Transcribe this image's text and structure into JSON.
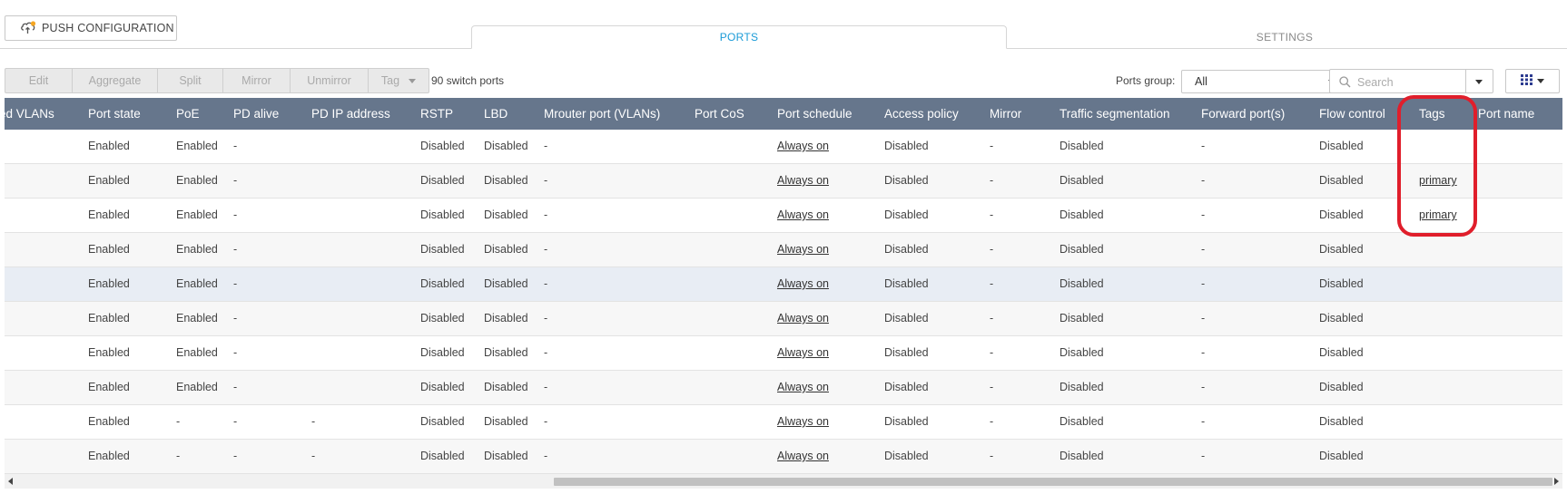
{
  "push_button": {
    "label": "PUSH CONFIGURATION",
    "icon": "cloud-upload-icon"
  },
  "tabs": [
    {
      "label": "PORTS",
      "active": true
    },
    {
      "label": "SETTINGS",
      "active": false
    }
  ],
  "toolbar": {
    "buttons": [
      "Edit",
      "Aggregate",
      "Split",
      "Mirror",
      "Unmirror",
      "Tag"
    ],
    "count_label": "90 switch ports",
    "ports_group_label": "Ports group:",
    "ports_group_value": "All",
    "search_placeholder": "Search"
  },
  "table": {
    "columns": [
      "ed VLANs",
      "Port state",
      "PoE",
      "PD alive",
      "PD IP address",
      "RSTP",
      "LBD",
      "Mrouter port (VLANs)",
      "Port CoS",
      "Port schedule",
      "Access policy",
      "Mirror",
      "Traffic segmentation",
      "Forward port(s)",
      "Flow control",
      "Tags",
      "Port name"
    ],
    "rows": [
      [
        "",
        "Enabled",
        "Enabled",
        "-",
        "",
        "Disabled",
        "Disabled",
        "-",
        "",
        "Always on",
        "Disabled",
        "-",
        "Disabled",
        "-",
        "Disabled",
        "",
        ""
      ],
      [
        "",
        "Enabled",
        "Enabled",
        "-",
        "",
        "Disabled",
        "Disabled",
        "-",
        "",
        "Always on",
        "Disabled",
        "-",
        "Disabled",
        "-",
        "Disabled",
        "primary",
        ""
      ],
      [
        "",
        "Enabled",
        "Enabled",
        "-",
        "",
        "Disabled",
        "Disabled",
        "-",
        "",
        "Always on",
        "Disabled",
        "-",
        "Disabled",
        "-",
        "Disabled",
        "primary",
        ""
      ],
      [
        "",
        "Enabled",
        "Enabled",
        "-",
        "",
        "Disabled",
        "Disabled",
        "-",
        "",
        "Always on",
        "Disabled",
        "-",
        "Disabled",
        "-",
        "Disabled",
        "",
        ""
      ],
      [
        "",
        "Enabled",
        "Enabled",
        "-",
        "",
        "Disabled",
        "Disabled",
        "-",
        "",
        "Always on",
        "Disabled",
        "-",
        "Disabled",
        "-",
        "Disabled",
        "",
        ""
      ],
      [
        "",
        "Enabled",
        "Enabled",
        "-",
        "",
        "Disabled",
        "Disabled",
        "-",
        "",
        "Always on",
        "Disabled",
        "-",
        "Disabled",
        "-",
        "Disabled",
        "",
        ""
      ],
      [
        "",
        "Enabled",
        "Enabled",
        "-",
        "",
        "Disabled",
        "Disabled",
        "-",
        "",
        "Always on",
        "Disabled",
        "-",
        "Disabled",
        "-",
        "Disabled",
        "",
        ""
      ],
      [
        "",
        "Enabled",
        "Enabled",
        "-",
        "",
        "Disabled",
        "Disabled",
        "-",
        "",
        "Always on",
        "Disabled",
        "-",
        "Disabled",
        "-",
        "Disabled",
        "",
        ""
      ],
      [
        "",
        "Enabled",
        "-",
        "-",
        "-",
        "Disabled",
        "Disabled",
        "-",
        "",
        "Always on",
        "Disabled",
        "-",
        "Disabled",
        "-",
        "Disabled",
        "",
        ""
      ],
      [
        "",
        "Enabled",
        "-",
        "-",
        "-",
        "Disabled",
        "Disabled",
        "-",
        "",
        "Always on",
        "Disabled",
        "-",
        "Disabled",
        "-",
        "Disabled",
        "",
        ""
      ]
    ],
    "selected_row": 4,
    "link_columns": [
      9,
      15
    ]
  },
  "colors": {
    "header_bg": "#66768c",
    "tab_active": "#1a9bd7",
    "highlight": "#e01e2b"
  }
}
